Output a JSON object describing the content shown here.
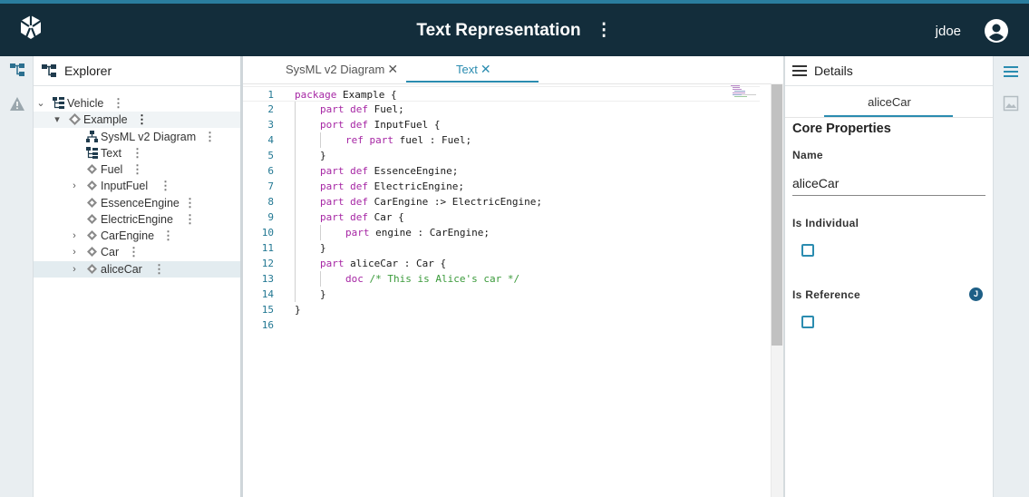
{
  "header": {
    "title": "Text Representation",
    "menu_glyph": "⋮",
    "username": "jdoe",
    "logo_icon": "sirius-logo-icon",
    "avatar_icon": "account-circle-icon"
  },
  "left_rail": {
    "items": [
      {
        "icon": "explorer-tree-icon"
      },
      {
        "icon": "warning-icon"
      }
    ]
  },
  "explorer": {
    "title": "Explorer",
    "tree": [
      {
        "label": "Vehicle",
        "depth": 0,
        "expander": "⌄",
        "icon": "document-tree-icon"
      },
      {
        "label": "Example",
        "depth": 1,
        "expander": "▾",
        "icon": "package-icon"
      },
      {
        "label": "SysML v2 Diagram",
        "depth": 2,
        "expander": "",
        "icon": "diagram-icon"
      },
      {
        "label": "Text",
        "depth": 2,
        "expander": "",
        "icon": "text-representation-icon"
      },
      {
        "label": "Fuel",
        "depth": 2,
        "expander": "",
        "icon": "part-def-icon"
      },
      {
        "label": "InputFuel",
        "depth": 2,
        "expander": "›",
        "icon": "port-def-icon"
      },
      {
        "label": "EssenceEngine",
        "depth": 2,
        "expander": "",
        "icon": "part-def-icon"
      },
      {
        "label": "ElectricEngine",
        "depth": 2,
        "expander": "",
        "icon": "part-def-icon"
      },
      {
        "label": "CarEngine",
        "depth": 2,
        "expander": "›",
        "icon": "part-def-icon"
      },
      {
        "label": "Car",
        "depth": 2,
        "expander": "›",
        "icon": "part-def-icon"
      },
      {
        "label": "aliceCar",
        "depth": 2,
        "expander": "›",
        "icon": "part-usage-icon"
      }
    ],
    "kebab": "⋮"
  },
  "editor": {
    "tabs": [
      {
        "label": "SysML v2 Diagram",
        "close": "✕"
      },
      {
        "label": "Text",
        "close": "✕"
      }
    ],
    "lines": [
      {
        "n": "1",
        "indent": 0,
        "kw": "package",
        "rest": " Example {"
      },
      {
        "n": "2",
        "indent": 1,
        "kw": "part def",
        "rest": " Fuel;"
      },
      {
        "n": "3",
        "indent": 1,
        "kw": "port def",
        "rest": " InputFuel {"
      },
      {
        "n": "4",
        "indent": 2,
        "kw": "ref part",
        "rest": " fuel : Fuel;"
      },
      {
        "n": "5",
        "indent": 1,
        "kw": "",
        "rest": "}"
      },
      {
        "n": "6",
        "indent": 1,
        "kw": "part def",
        "rest": " EssenceEngine;"
      },
      {
        "n": "7",
        "indent": 1,
        "kw": "part def",
        "rest": " ElectricEngine;"
      },
      {
        "n": "8",
        "indent": 1,
        "kw": "part def",
        "rest": " CarEngine :> ElectricEngine;"
      },
      {
        "n": "9",
        "indent": 1,
        "kw": "part def",
        "rest": " Car {"
      },
      {
        "n": "10",
        "indent": 2,
        "kw": "part",
        "rest": " engine : CarEngine;"
      },
      {
        "n": "11",
        "indent": 1,
        "kw": "",
        "rest": "}"
      },
      {
        "n": "12",
        "indent": 1,
        "kw": "part",
        "rest": " aliceCar : Car {"
      },
      {
        "n": "13",
        "indent": 2,
        "kw": "doc",
        "rest": " /* This is Alice's car */"
      },
      {
        "n": "14",
        "indent": 1,
        "kw": "",
        "rest": "}"
      },
      {
        "n": "15",
        "indent": 0,
        "kw": "",
        "rest": "}"
      },
      {
        "n": "16",
        "indent": 0,
        "kw": "",
        "rest": ""
      }
    ]
  },
  "details": {
    "title": "Details",
    "tab": "aliceCar",
    "section": "Core Properties",
    "name_label": "Name",
    "name_value": "aliceCar",
    "is_individual_label": "Is Individual",
    "is_individual_checked": false,
    "is_reference_label": "Is Reference",
    "is_reference_checked": false,
    "help_badge": "J"
  },
  "right_rail": {
    "items": [
      {
        "icon": "details-list-icon"
      },
      {
        "icon": "image-representation-icon"
      }
    ]
  },
  "colors": {
    "header_bg": "#132d3b",
    "accent": "#2b8cb0",
    "keyword": "#a626a4",
    "comment": "#3a9a3a",
    "line_number": "#237893"
  }
}
